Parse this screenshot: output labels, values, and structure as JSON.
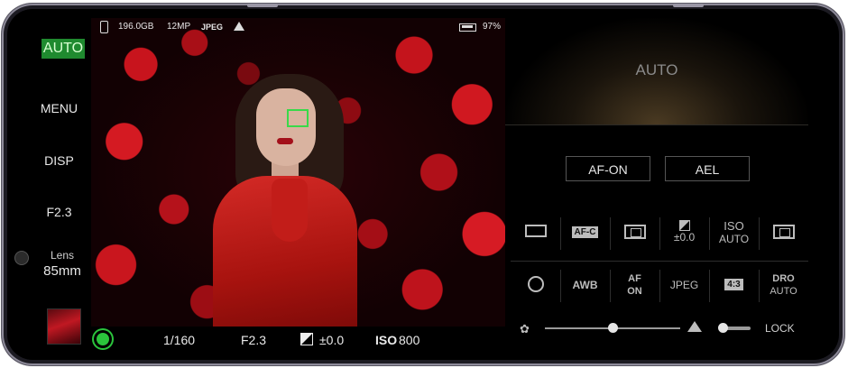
{
  "left_panel": {
    "mode_badge": "AUTO",
    "menu_label": "MENU",
    "disp_label": "DISP",
    "aperture_label": "F2.3",
    "lens_label": "Lens",
    "lens_value": "85mm"
  },
  "status_bar": {
    "storage": "196.0GB",
    "resolution": "12MP",
    "format": "JPEG",
    "battery": "97%"
  },
  "bottom_bar": {
    "shutter": "1/160",
    "aperture": "F2.3",
    "exposure": "±0.0",
    "iso_label": "ISO",
    "iso_value": "800"
  },
  "right_panel": {
    "mode_text": "AUTO",
    "af_on_label": "AF-ON",
    "ael_label": "AEL",
    "settings_row1": [
      {
        "icon": "drive-single-icon",
        "label": ""
      },
      {
        "icon": "af-c-icon",
        "label": "AF-C"
      },
      {
        "icon": "focus-area-icon",
        "label": ""
      },
      {
        "icon": "exposure-comp-icon",
        "label": "±0.0"
      },
      {
        "icon": "iso-icon",
        "label": "ISO",
        "sub": "AUTO"
      },
      {
        "icon": "metering-icon",
        "label": ""
      }
    ],
    "settings_row2": [
      {
        "icon": "flash-off-icon",
        "label": ""
      },
      {
        "icon": "white-balance-icon",
        "label": "AWB"
      },
      {
        "icon": "face-eye-af-icon",
        "label": "AF",
        "sub": "ON"
      },
      {
        "icon": "file-format-icon",
        "label": "JPEG"
      },
      {
        "icon": "aspect-ratio-icon",
        "label": "4:3"
      },
      {
        "icon": "dro-icon",
        "label": "DRO",
        "sub": "AUTO"
      }
    ],
    "focus_slider_value": 0.5,
    "lock_label": "LOCK"
  },
  "colors": {
    "auto_green": "#1f8a2f",
    "af_box": "#39d94a"
  }
}
